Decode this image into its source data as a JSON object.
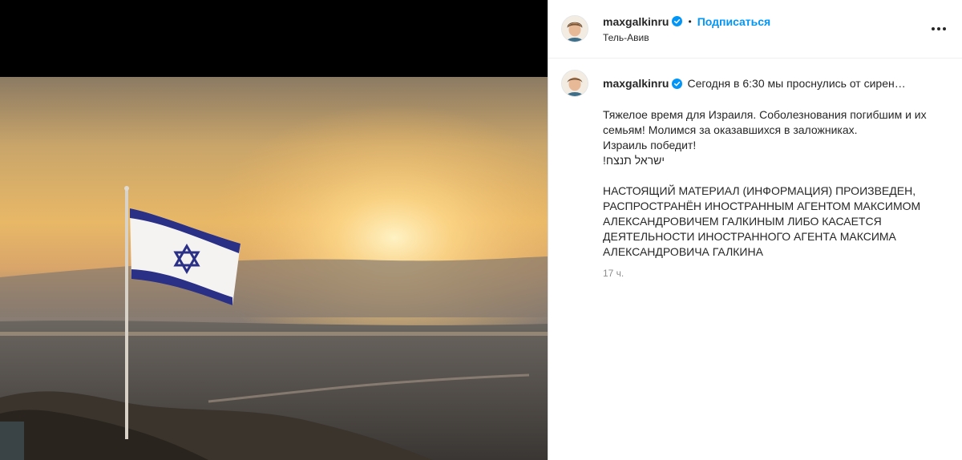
{
  "post": {
    "username": "maxgalkinru",
    "follow_label": "Подписаться",
    "separator": "•",
    "location": "Тель-Авив",
    "caption_intro": "Сегодня в 6:30 мы проснулись от сирен…",
    "caption_body": "Тяжелое время для Израиля. Соболезнования погибшим и их семьям! Молимся за оказавшихся в заложниках.\nИзраиль победит!\n!ישראל תנצח\n\nНАСТОЯЩИЙ МАТЕРИАЛ (ИНФОРМАЦИЯ) ПРОИЗВЕДЕН, РАСПРОСТРАНЁН ИНОСТРАННЫМ АГЕНТОМ МАКСИМОМ АЛЕКСАНДРОВИЧЕМ ГАЛКИНЫМ ЛИБО КАСАЕТСЯ ДЕЯТЕЛЬНОСТИ ИНОСТРАННОГО АГЕНТА МАКСИМА АЛЕКСАНДРОВИЧА ГАЛКИНА",
    "time_ago": "17 ч."
  },
  "icons": {
    "verified": "verified-badge-icon",
    "more": "more-options-icon"
  },
  "colors": {
    "accent": "#0095f6",
    "text": "#262626",
    "secondary": "#8e8e8e",
    "flag_blue": "#1f2a8a"
  }
}
